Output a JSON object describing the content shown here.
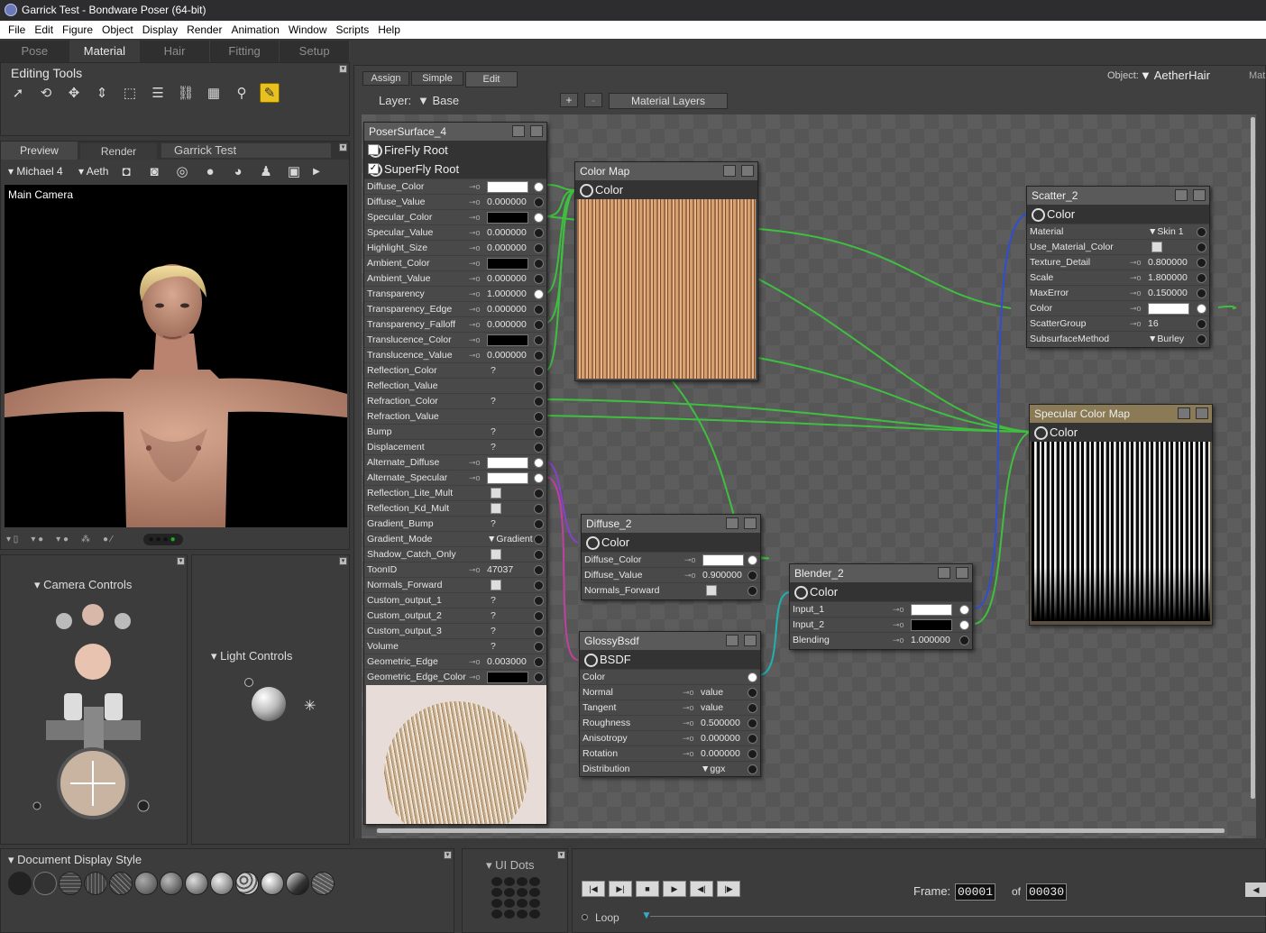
{
  "window": {
    "title": "Garrick Test - Bondware Poser (64-bit)"
  },
  "menu": [
    "File",
    "Edit",
    "Figure",
    "Object",
    "Display",
    "Render",
    "Animation",
    "Window",
    "Scripts",
    "Help"
  ],
  "rooms": [
    {
      "label": "Pose",
      "active": false
    },
    {
      "label": "Material",
      "active": true
    },
    {
      "label": "Hair",
      "active": false
    },
    {
      "label": "Fitting",
      "active": false
    },
    {
      "label": "Setup",
      "active": false
    }
  ],
  "editing_tools": {
    "title": "Editing Tools",
    "tools": [
      "pointer-icon",
      "rotate-icon",
      "translate-icon",
      "updown-icon",
      "scale-icon",
      "taper-icon",
      "chain-icon",
      "grid-icon",
      "magnifier-icon",
      "eyedropper-icon"
    ]
  },
  "preview": {
    "tabs": [
      "Preview",
      "Render"
    ],
    "doc_name": "Garrick Test",
    "figure": "Michael 4",
    "actor": "Aeth",
    "camera_label": "Main Camera"
  },
  "camera_controls": {
    "title": "Camera Controls"
  },
  "light_controls": {
    "title": "Light Controls"
  },
  "doc_display": {
    "title": "Document Display Style"
  },
  "ui_dots": {
    "title": "UI Dots"
  },
  "material_tabs": [
    "Assign",
    "Simple",
    "Edit"
  ],
  "material_active_tab": "Edit",
  "object": {
    "label": "Object:",
    "value": "AetherHair",
    "extra": "Mat"
  },
  "layer": {
    "label": "Layer:",
    "value": "Base",
    "add": "+",
    "remove": "-",
    "button": "Material Layers"
  },
  "poser_surface": {
    "title": "PoserSurface_4",
    "firefly": "FireFly Root",
    "firefly_checked": false,
    "superfly": "SuperFly Root",
    "superfly_checked": true,
    "rows": [
      {
        "name": "Diffuse_Color",
        "kind": "swatch",
        "color": "#ffffff",
        "linked": true
      },
      {
        "name": "Diffuse_Value",
        "kind": "num",
        "value": "0.000000"
      },
      {
        "name": "Specular_Color",
        "kind": "swatch",
        "color": "#000000",
        "linked": true
      },
      {
        "name": "Specular_Value",
        "kind": "num",
        "value": "0.000000"
      },
      {
        "name": "Highlight_Size",
        "kind": "num",
        "value": "0.000000"
      },
      {
        "name": "Ambient_Color",
        "kind": "swatch",
        "color": "#000000"
      },
      {
        "name": "Ambient_Value",
        "kind": "num",
        "value": "0.000000"
      },
      {
        "name": "Transparency",
        "kind": "num",
        "value": "1.000000",
        "linked": true
      },
      {
        "name": "Transparency_Edge",
        "kind": "num",
        "value": "0.000000"
      },
      {
        "name": "Transparency_Falloff",
        "kind": "num",
        "value": "0.000000"
      },
      {
        "name": "Translucence_Color",
        "kind": "swatch",
        "color": "#000000"
      },
      {
        "name": "Translucence_Value",
        "kind": "num",
        "value": "0.000000"
      },
      {
        "name": "Reflection_Color",
        "kind": "q",
        "value": "?"
      },
      {
        "name": "Reflection_Value",
        "kind": "none"
      },
      {
        "name": "Refraction_Color",
        "kind": "q",
        "value": "?"
      },
      {
        "name": "Refraction_Value",
        "kind": "none"
      },
      {
        "name": "Bump",
        "kind": "q",
        "value": "?"
      },
      {
        "name": "Displacement",
        "kind": "q",
        "value": "?"
      },
      {
        "name": "Alternate_Diffuse",
        "kind": "swatch",
        "color": "#ffffff",
        "linked": true
      },
      {
        "name": "Alternate_Specular",
        "kind": "swatch",
        "color": "#ffffff",
        "linked": true
      },
      {
        "name": "Reflection_Lite_Mult",
        "kind": "check"
      },
      {
        "name": "Reflection_Kd_Mult",
        "kind": "check"
      },
      {
        "name": "Gradient_Bump",
        "kind": "q",
        "value": "?"
      },
      {
        "name": "Gradient_Mode",
        "kind": "menu",
        "value": "Gradient B"
      },
      {
        "name": "Shadow_Catch_Only",
        "kind": "check"
      },
      {
        "name": "ToonID",
        "kind": "num",
        "value": "47037"
      },
      {
        "name": "Normals_Forward",
        "kind": "check"
      },
      {
        "name": "Custom_output_1",
        "kind": "q",
        "value": "?"
      },
      {
        "name": "Custom_output_2",
        "kind": "q",
        "value": "?"
      },
      {
        "name": "Custom_output_3",
        "kind": "q",
        "value": "?"
      },
      {
        "name": "Volume",
        "kind": "q",
        "value": "?"
      },
      {
        "name": "Geometric_Edge",
        "kind": "num",
        "value": "0.003000"
      },
      {
        "name": "Geometric_Edge_Color",
        "kind": "swatch",
        "color": "#000000"
      }
    ]
  },
  "color_map": {
    "title": "Color Map",
    "output": "Color"
  },
  "scatter": {
    "title": "Scatter_2",
    "output": "Color",
    "rows": [
      {
        "name": "Material",
        "kind": "menu",
        "value": "Skin 1"
      },
      {
        "name": "Use_Material_Color",
        "kind": "check"
      },
      {
        "name": "Texture_Detail",
        "kind": "num",
        "value": "0.800000"
      },
      {
        "name": "Scale",
        "kind": "num",
        "value": "1.800000"
      },
      {
        "name": "MaxError",
        "kind": "num",
        "value": "0.150000"
      },
      {
        "name": "Color",
        "kind": "swatch",
        "color": "#ffffff",
        "linked": true
      },
      {
        "name": "ScatterGroup",
        "kind": "num",
        "value": "16"
      },
      {
        "name": "SubsurfaceMethod",
        "kind": "menu",
        "value": "Burley"
      }
    ]
  },
  "spec_map": {
    "title": "Specular Color Map",
    "output": "Color"
  },
  "diffuse": {
    "title": "Diffuse_2",
    "output": "Color",
    "rows": [
      {
        "name": "Diffuse_Color",
        "kind": "swatch",
        "color": "#ffffff",
        "linked": true
      },
      {
        "name": "Diffuse_Value",
        "kind": "num",
        "value": "0.900000"
      },
      {
        "name": "Normals_Forward",
        "kind": "check"
      }
    ]
  },
  "glossy": {
    "title": "GlossyBsdf",
    "output": "BSDF",
    "rows": [
      {
        "name": "Color",
        "kind": "none",
        "linked": true
      },
      {
        "name": "Normal",
        "kind": "num",
        "value": "value"
      },
      {
        "name": "Tangent",
        "kind": "num",
        "value": "value"
      },
      {
        "name": "Roughness",
        "kind": "num",
        "value": "0.500000"
      },
      {
        "name": "Anisotropy",
        "kind": "num",
        "value": "0.000000"
      },
      {
        "name": "Rotation",
        "kind": "num",
        "value": "0.000000"
      },
      {
        "name": "Distribution",
        "kind": "menu",
        "value": "ggx"
      }
    ]
  },
  "blender": {
    "title": "Blender_2",
    "output": "Color",
    "rows": [
      {
        "name": "Input_1",
        "kind": "swatch",
        "color": "#ffffff",
        "linked": true
      },
      {
        "name": "Input_2",
        "kind": "swatch",
        "color": "#000000",
        "linked": true
      },
      {
        "name": "Blending",
        "kind": "num",
        "value": "1.000000"
      }
    ]
  },
  "timeline": {
    "frame_label": "Frame:",
    "frame": "00001",
    "of": "of",
    "total": "00030",
    "loop": "Loop"
  },
  "colors": {
    "accent_yellow": "#e8c020",
    "link_green": "#3fbf3f",
    "link_blue": "#2f4fd0",
    "link_purple": "#8a3fd0",
    "link_magenta": "#c040a0",
    "link_cyan": "#20b0b0"
  }
}
